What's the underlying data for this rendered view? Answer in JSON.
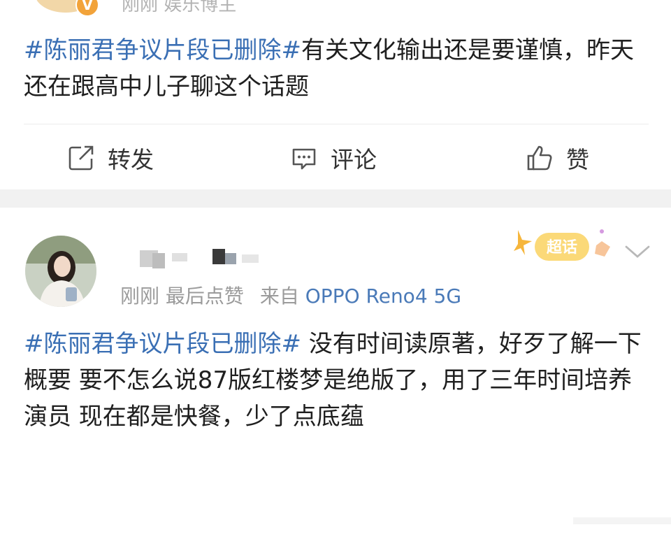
{
  "post1": {
    "meta": "刚刚 娱乐博主",
    "hashtag": "#陈丽君争议片段已删除#",
    "text": "有关文化输出还是要谨慎，昨天还在跟高中儿子聊这个话题"
  },
  "actions": {
    "repost_label": "转发",
    "comment_label": "评论",
    "like_label": "赞"
  },
  "post2": {
    "time": "刚刚",
    "liked": "最后点赞",
    "from": "来自",
    "device": "OPPO Reno4 5G",
    "badge": "超话",
    "hashtag": "#陈丽君争议片段已删除#",
    "text": " 没有时间读原著，好歹了解一下概要 要不怎么说87版红楼梦是绝版了，用了三年时间培养演员 现在都是快餐，少了点底蕴"
  },
  "colors": {
    "link": "#3a6fb4",
    "meta": "#9b9b9b",
    "gap": "#f1f1f1"
  }
}
